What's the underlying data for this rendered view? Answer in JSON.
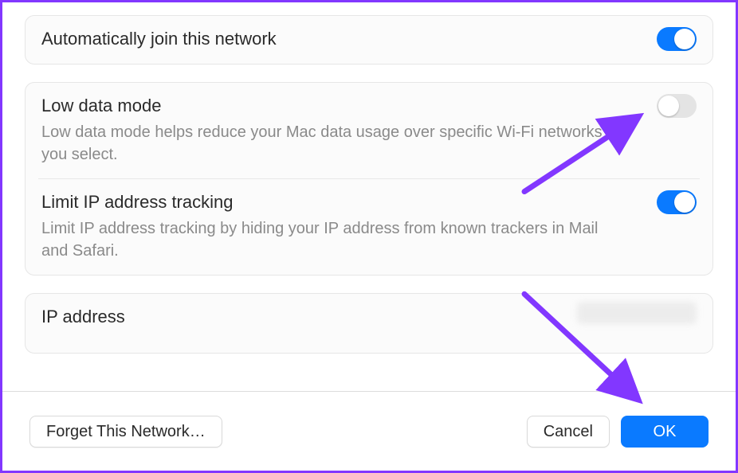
{
  "colors": {
    "accent_blue": "#0a7aff",
    "annotation_purple": "#8237ff",
    "text_primary": "#2a2a2a",
    "text_secondary": "#8a8a8a",
    "toggle_off_bg": "#e4e4e4",
    "card_bg": "#fbfbfb",
    "border": "#e6e6e6"
  },
  "settings": {
    "auto_join": {
      "title": "Automatically join this network",
      "on": true
    },
    "low_data": {
      "title": "Low data mode",
      "desc": "Low data mode helps reduce your Mac data usage over specific Wi-Fi networks you select.",
      "on": false
    },
    "limit_ip": {
      "title": "Limit IP address tracking",
      "desc": "Limit IP address tracking by hiding your IP address from known trackers in Mail and Safari.",
      "on": true
    },
    "ip": {
      "title": "IP address",
      "value": ""
    }
  },
  "footer": {
    "forget": "Forget This Network…",
    "cancel": "Cancel",
    "ok": "OK"
  }
}
